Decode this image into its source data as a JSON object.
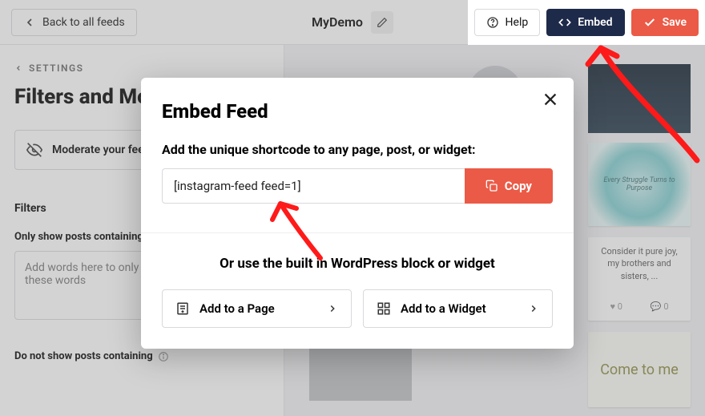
{
  "header": {
    "back_label": "Back to all feeds",
    "title": "MyDemo",
    "help_label": "Help",
    "embed_label": "Embed",
    "save_label": "Save"
  },
  "sidebar": {
    "settings_link": "SETTINGS",
    "page_title": "Filters and Moderation",
    "moderate_label": "Moderate your feed",
    "filters_heading": "Filters",
    "only_show_label": "Only show posts containing",
    "only_show_placeholder": "Add words here to only show posts containing these words",
    "dont_show_label": "Do not show posts containing"
  },
  "preview": {
    "card_text": "Consider it pure joy, my brothers and sisters, ...",
    "card_likes": "0",
    "card_comments": "0",
    "teal_text": "Every Struggle Turns to Purpose",
    "olive_text": "Come to me"
  },
  "modal": {
    "title": "Embed Feed",
    "subtitle": "Add the unique shortcode to any page, post, or widget:",
    "shortcode": "[instagram-feed feed=1]",
    "copy_label": "Copy",
    "or_text": "Or use the built in WordPress block or widget",
    "add_page_label": "Add to a Page",
    "add_widget_label": "Add to a Widget"
  }
}
